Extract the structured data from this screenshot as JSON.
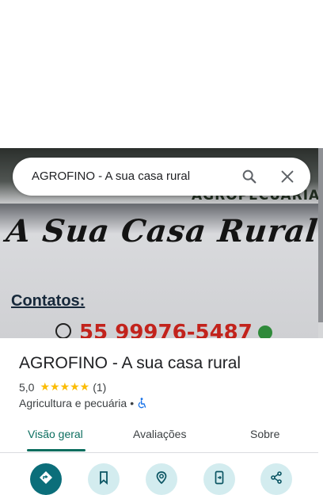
{
  "search": {
    "query": "AGROFINO - A sua casa rural"
  },
  "hero": {
    "brand_sub": "AGROPECUÁRIA",
    "slogan": "A Sua Casa Rural",
    "contacts_label": "Contatos:",
    "phone": "55 99976-5487"
  },
  "place": {
    "name": "AGROFINO - A sua casa rural",
    "rating": "5,0",
    "stars": "★★★★★",
    "review_count": "(1)",
    "category": "Agricultura e pecuária",
    "separator": "•"
  },
  "tabs": [
    {
      "label": "Visão geral",
      "active": true
    },
    {
      "label": "Avaliações",
      "active": false
    },
    {
      "label": "Sobre",
      "active": false
    }
  ],
  "actions": [
    {
      "icon": "directions-icon"
    },
    {
      "icon": "bookmark-icon"
    },
    {
      "icon": "nearby-icon"
    },
    {
      "icon": "send-to-phone-icon"
    },
    {
      "icon": "share-icon"
    }
  ],
  "colors": {
    "accent": "#0b6e5f",
    "star": "#fbbc04",
    "action_bg": "#d3ecef"
  }
}
